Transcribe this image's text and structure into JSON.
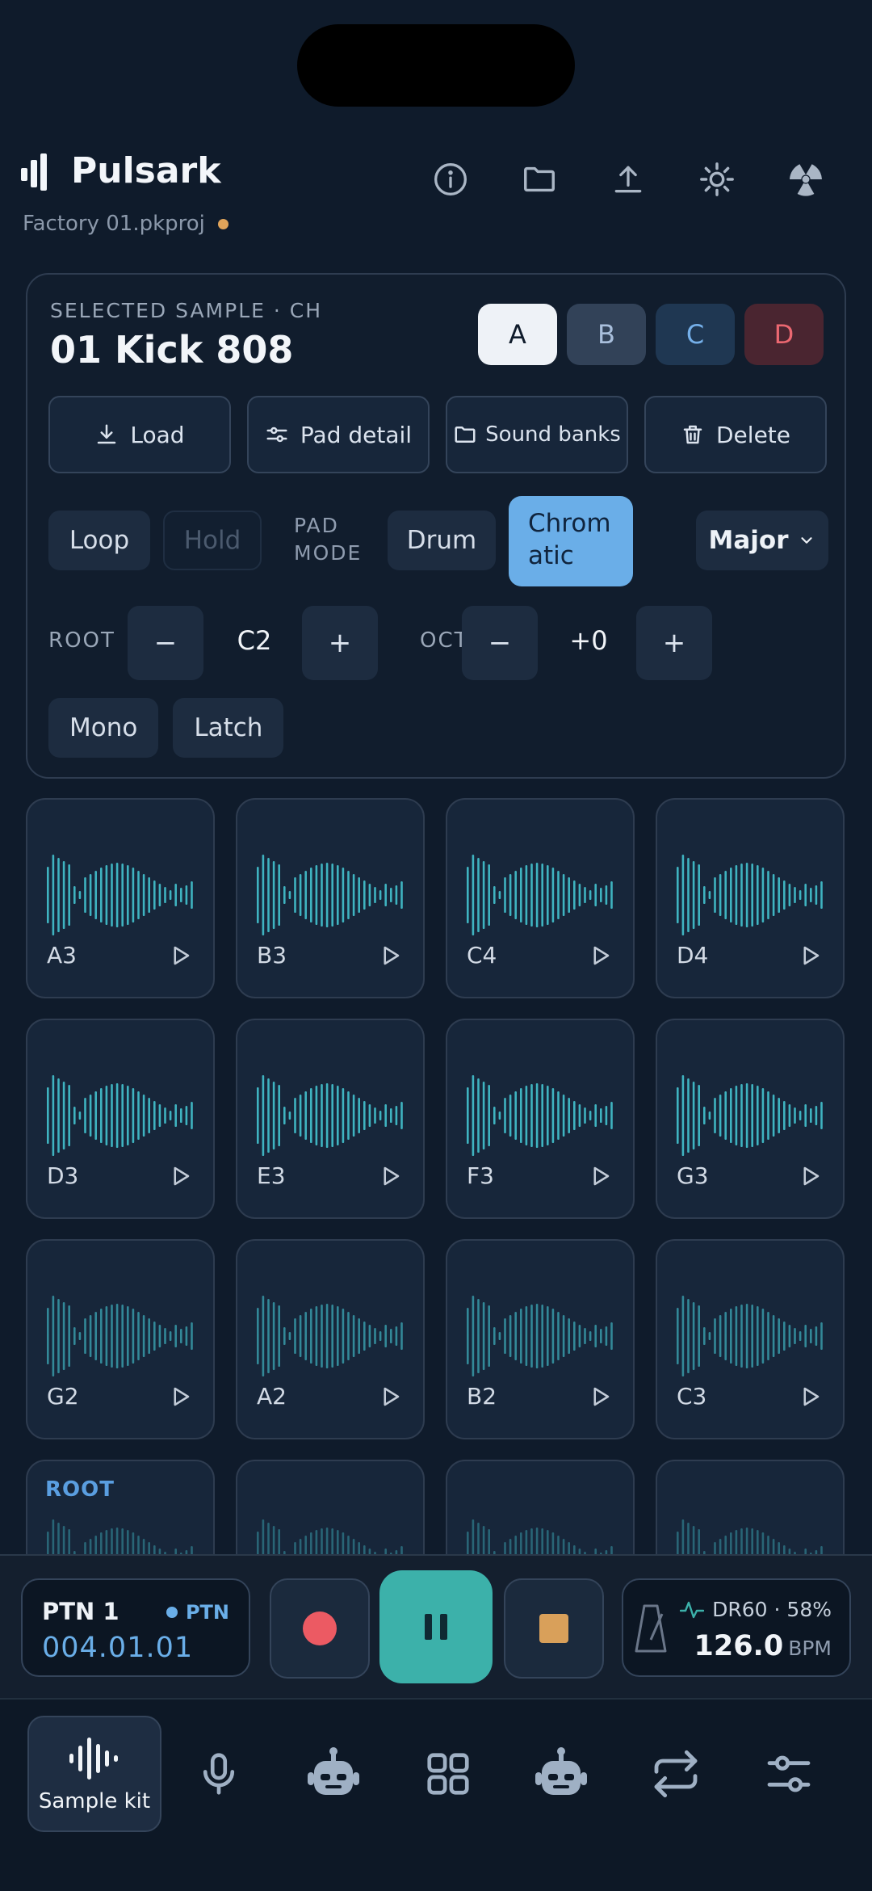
{
  "app": {
    "name": "Pulsark",
    "project": "Factory 01.pkproj"
  },
  "header_icons": [
    "info-icon",
    "folder-icon",
    "upload-icon",
    "settings-icon",
    "radiation-icon"
  ],
  "selected": {
    "label": "SELECTED SAMPLE · CH",
    "name": "01 Kick 808",
    "channels": [
      "A",
      "B",
      "C",
      "D"
    ],
    "active_channel": "A"
  },
  "actions": {
    "load": "Load",
    "pad_detail": "Pad detail",
    "sound_banks": "Sound banks",
    "delete": "Delete"
  },
  "mode": {
    "loop": "Loop",
    "hold": "Hold",
    "pad_mode_line1": "PAD",
    "pad_mode_line2": "MODE",
    "drum": "Drum",
    "chromatic_line1": "Chrom",
    "chromatic_line2": "atic",
    "scale": "Major"
  },
  "tuning": {
    "root_label": "ROOT",
    "root_value": "C2",
    "oct_label": "OCT",
    "oct_value": "+0",
    "minus": "−",
    "plus": "+"
  },
  "voice": {
    "mono": "Mono",
    "latch": "Latch"
  },
  "pads": {
    "row1": [
      "A3",
      "B3",
      "C4",
      "D4"
    ],
    "row2": [
      "D3",
      "E3",
      "F3",
      "G3"
    ],
    "row3": [
      "G2",
      "A2",
      "B2",
      "C3"
    ],
    "row4_root_label": "ROOT"
  },
  "transport": {
    "pattern": "PTN 1",
    "pattern_tag": "PTN",
    "position": "004.01.01",
    "swing_info": "DR60 · 58%",
    "bpm": "126.0",
    "bpm_unit": "BPM",
    "state": "playing"
  },
  "nav": {
    "active_label": "Sample kit",
    "items": [
      "sample-kit-icon",
      "microphone-icon",
      "robot-icon",
      "grid-icon",
      "robot-icon",
      "repeat-icon",
      "sliders-icon"
    ]
  },
  "colors": {
    "accent_blue": "#6aaee8",
    "accent_teal": "#3cb1aa",
    "record_red": "#ec5a63",
    "stop_orange": "#d9a05a",
    "wave_teal": "#3fb3c0",
    "channel_d_red": "#ec6871"
  }
}
